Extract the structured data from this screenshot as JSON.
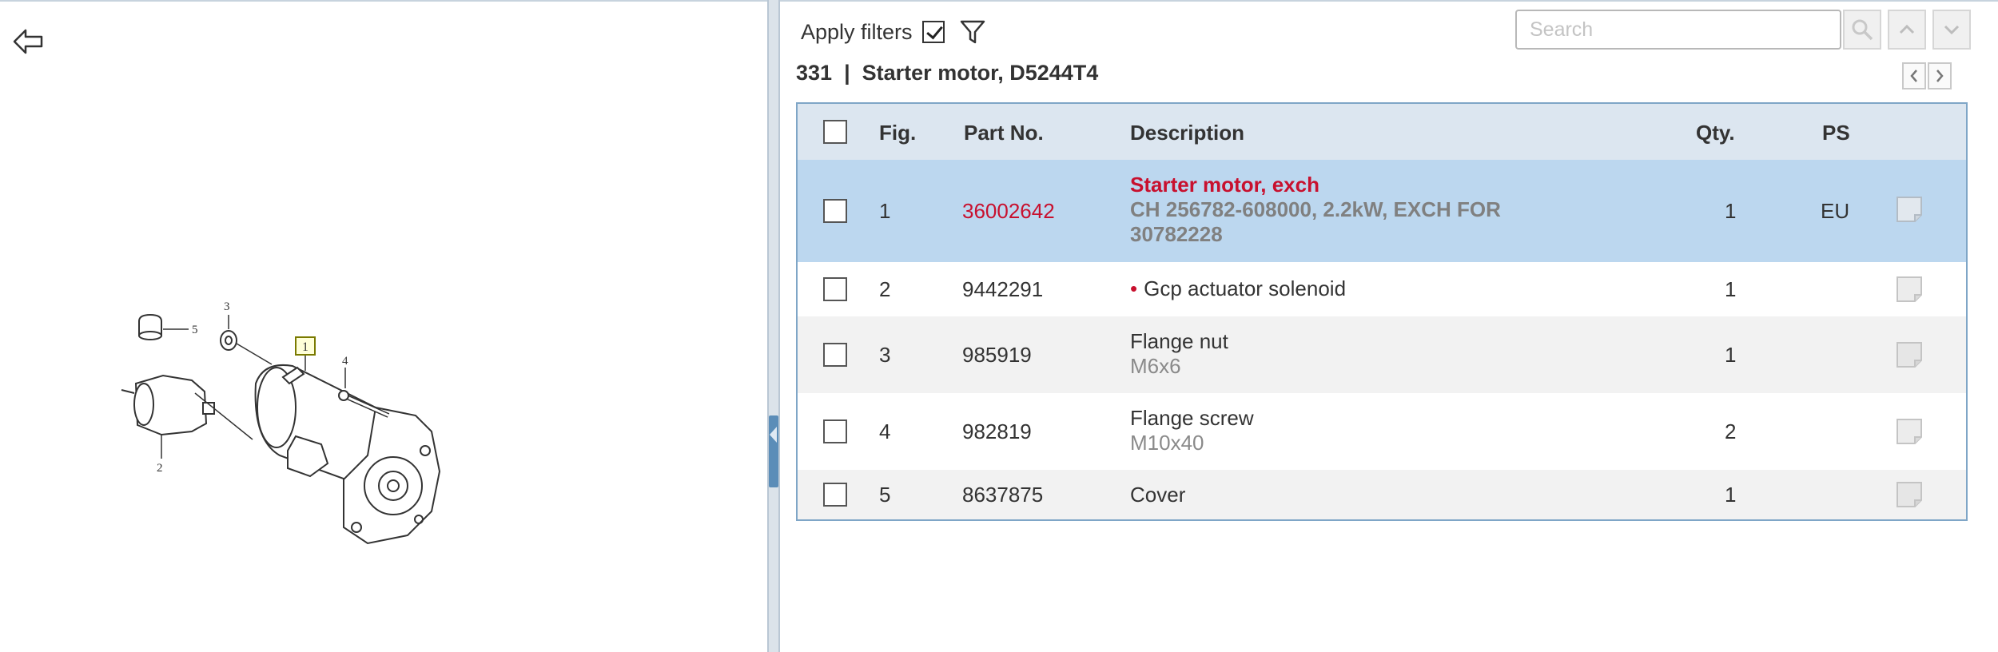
{
  "toolbar": {
    "apply_filters_label": "Apply filters",
    "apply_filters_checked": true,
    "search_placeholder": "Search"
  },
  "section": {
    "number": "331",
    "separator": "|",
    "title": "Starter motor, D5244T4"
  },
  "table": {
    "columns": {
      "fig": "Fig.",
      "part_no": "Part No.",
      "description": "Description",
      "qty": "Qty.",
      "ps": "PS"
    },
    "rows": [
      {
        "fig": "1",
        "part_no": "36002642",
        "desc_title": "Starter motor, exch",
        "desc_detail_1": "CH 256782-608000, 2.2kW, EXCH FOR",
        "desc_detail_2": "30782228",
        "qty": "1",
        "ps": "EU",
        "selected": true
      },
      {
        "fig": "2",
        "part_no": "9442291",
        "desc_title": "Gcp actuator solenoid",
        "bullet": "•",
        "qty": "1",
        "ps": ""
      },
      {
        "fig": "3",
        "part_no": "985919",
        "desc_title": "Flange nut",
        "desc_detail_1": "M6x6",
        "qty": "1",
        "ps": ""
      },
      {
        "fig": "4",
        "part_no": "982819",
        "desc_title": "Flange screw",
        "desc_detail_1": "M10x40",
        "qty": "2",
        "ps": ""
      },
      {
        "fig": "5",
        "part_no": "8637875",
        "desc_title": "Cover",
        "qty": "1",
        "ps": ""
      }
    ]
  },
  "diagram": {
    "callouts": {
      "c1": "1",
      "c2": "2",
      "c3": "3",
      "c4": "4",
      "c5": "5"
    }
  },
  "icons": [
    "back-arrow-icon",
    "filter-funnel-icon",
    "search-icon",
    "chevron-up-icon",
    "chevron-down-icon",
    "chevron-left-icon",
    "chevron-right-icon",
    "note-icon"
  ],
  "colors": {
    "accent_red": "#c8102e",
    "header_bg": "#dce6f0",
    "selected_row": "#bcd7ef",
    "table_border": "#7fa6c7"
  }
}
